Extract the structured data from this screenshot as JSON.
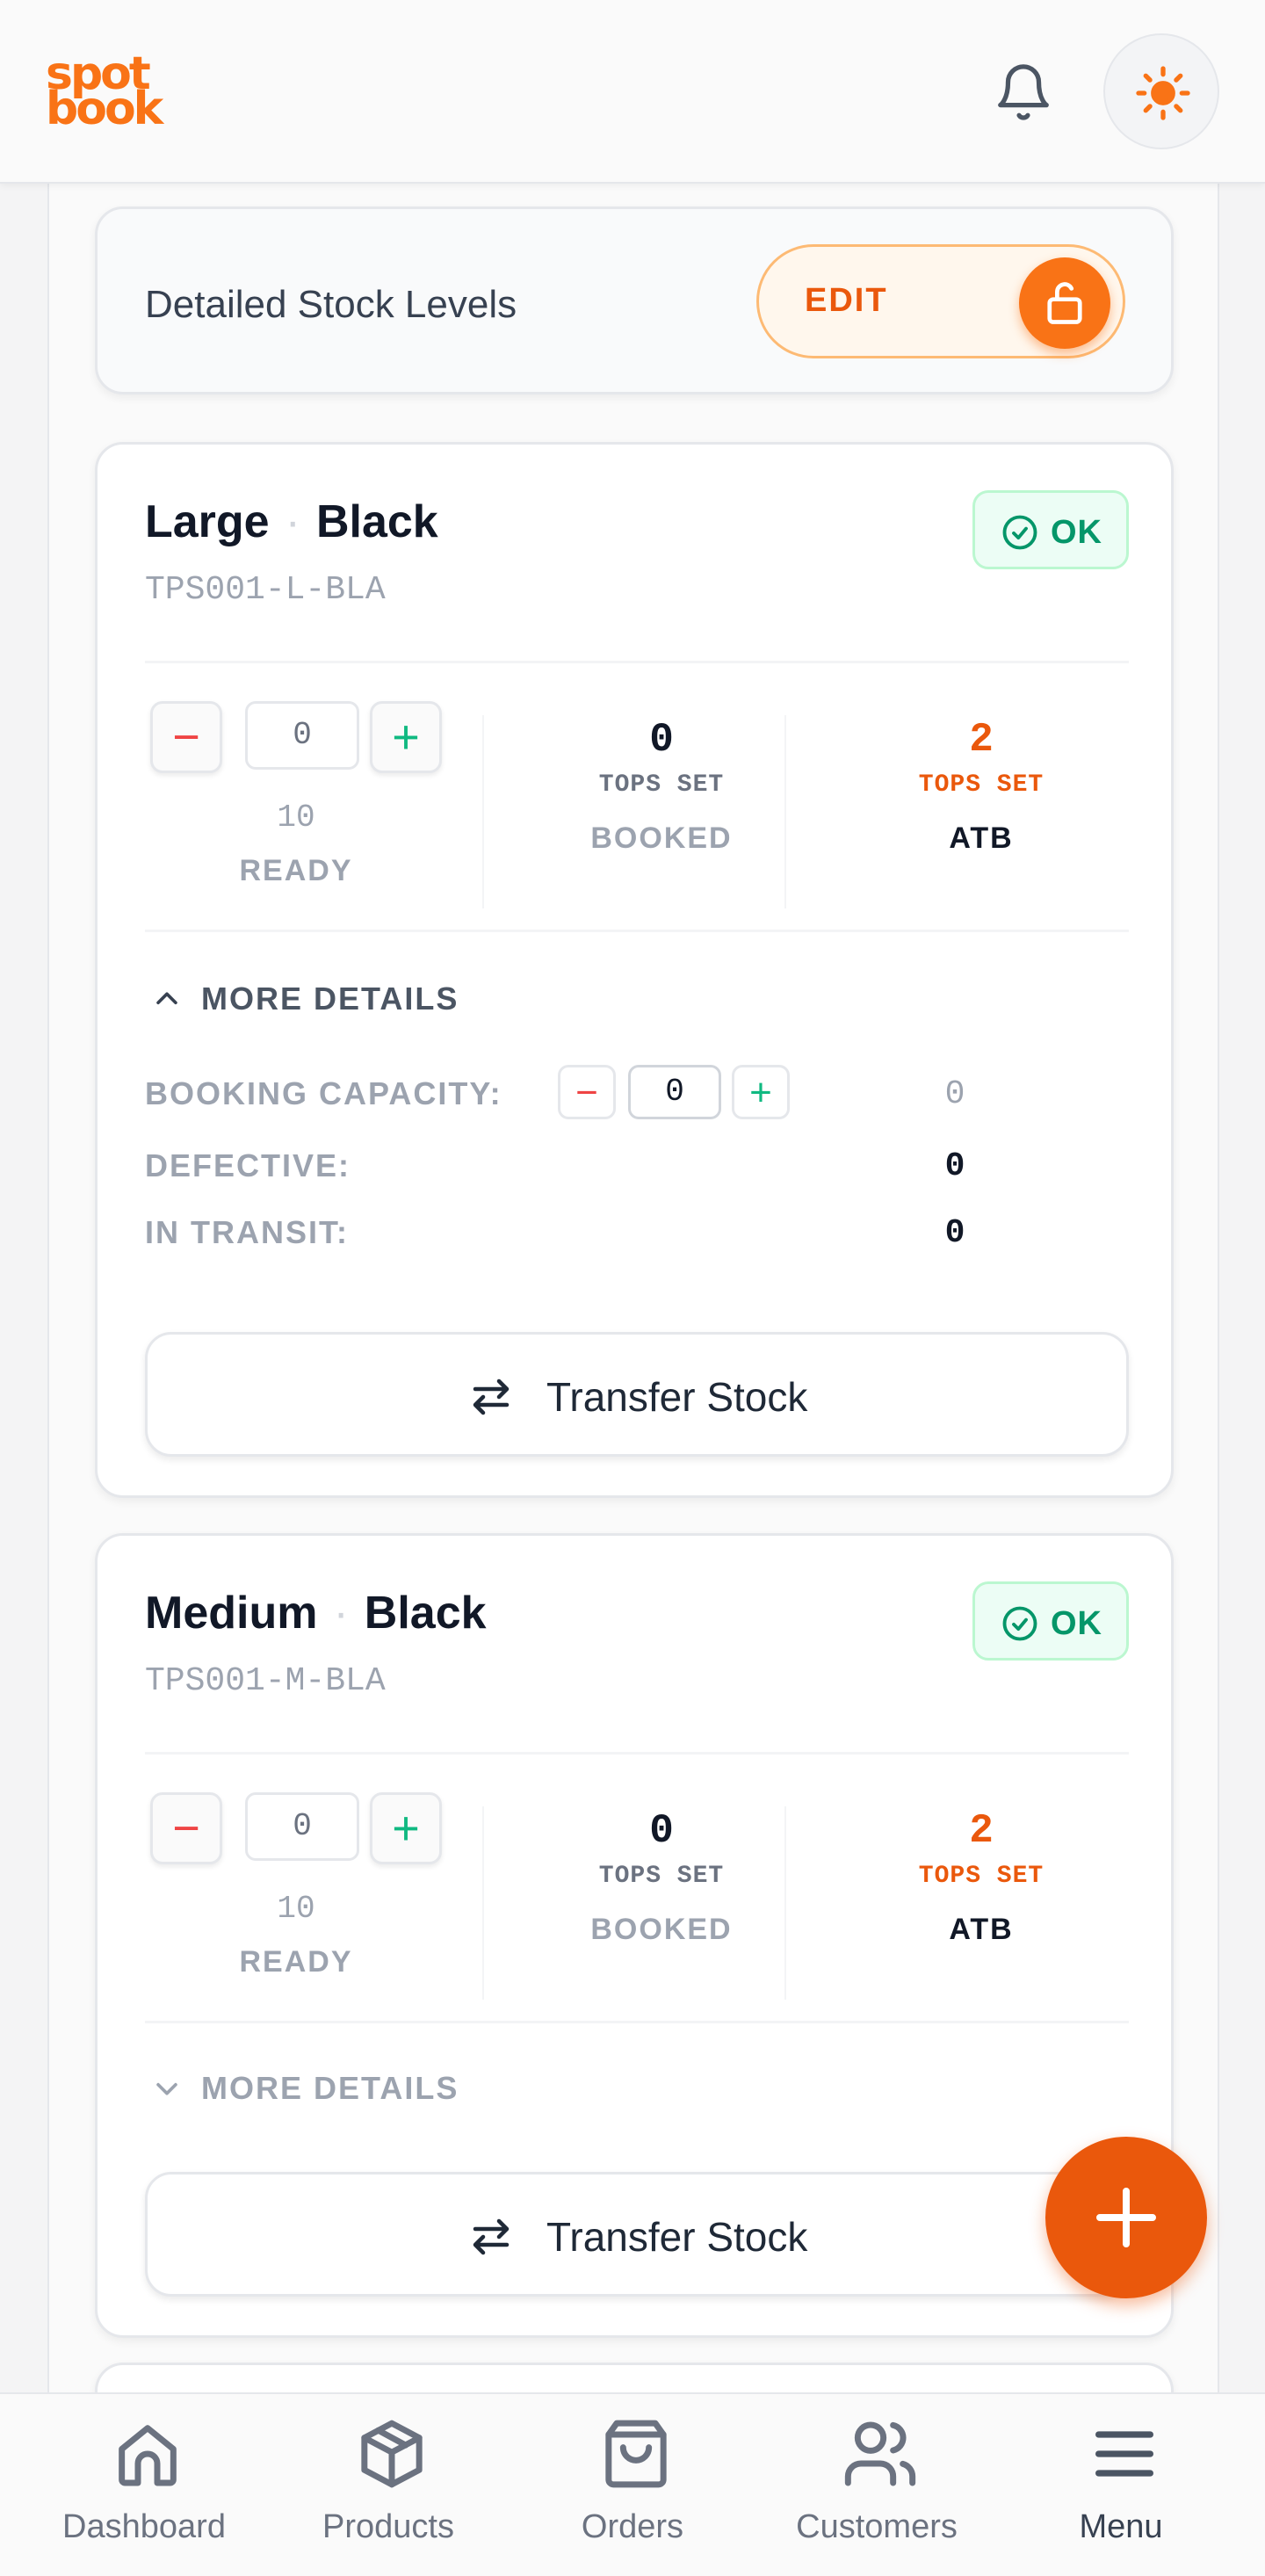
{
  "brand": {
    "logo_line1": "spot",
    "logo_line2": "book",
    "accent": "#f97316"
  },
  "stock_levels": {
    "title": "Detailed Stock Levels",
    "edit_label": "EDIT"
  },
  "variants": [
    {
      "size": "Large",
      "color": "Black",
      "sku": "TPS001-L-BLA",
      "status": "OK",
      "ready": {
        "input_value": "0",
        "count": "10",
        "label": "READY"
      },
      "booked": {
        "value": "0",
        "unit": "TOPS SET",
        "label": "BOOKED"
      },
      "atb": {
        "value": "2",
        "unit": "TOPS SET",
        "label": "ATB"
      },
      "more_details_label": "MORE DETAILS",
      "expanded": true,
      "details": {
        "booking_capacity_label": "BOOKING CAPACITY:",
        "booking_capacity_input": "0",
        "booking_capacity_value": "0",
        "defective_label": "DEFECTIVE:",
        "defective_value": "0",
        "in_transit_label": "IN TRANSIT:",
        "in_transit_value": "0"
      },
      "transfer_label": "Transfer Stock"
    },
    {
      "size": "Medium",
      "color": "Black",
      "sku": "TPS001-M-BLA",
      "status": "OK",
      "ready": {
        "input_value": "0",
        "count": "10",
        "label": "READY"
      },
      "booked": {
        "value": "0",
        "unit": "TOPS SET",
        "label": "BOOKED"
      },
      "atb": {
        "value": "2",
        "unit": "TOPS SET",
        "label": "ATB"
      },
      "more_details_label": "MORE DETAILS",
      "expanded": false,
      "transfer_label": "Transfer Stock"
    }
  ],
  "nav": {
    "items": [
      {
        "label": "Dashboard",
        "icon": "home-icon"
      },
      {
        "label": "Products",
        "icon": "box-icon"
      },
      {
        "label": "Orders",
        "icon": "shopping-bag-icon"
      },
      {
        "label": "Customers",
        "icon": "users-icon"
      },
      {
        "label": "Menu",
        "icon": "menu-icon"
      }
    ]
  },
  "colors": {
    "ok_green": "#059669",
    "danger": "#ef4444",
    "atb_orange": "#ea580c"
  }
}
